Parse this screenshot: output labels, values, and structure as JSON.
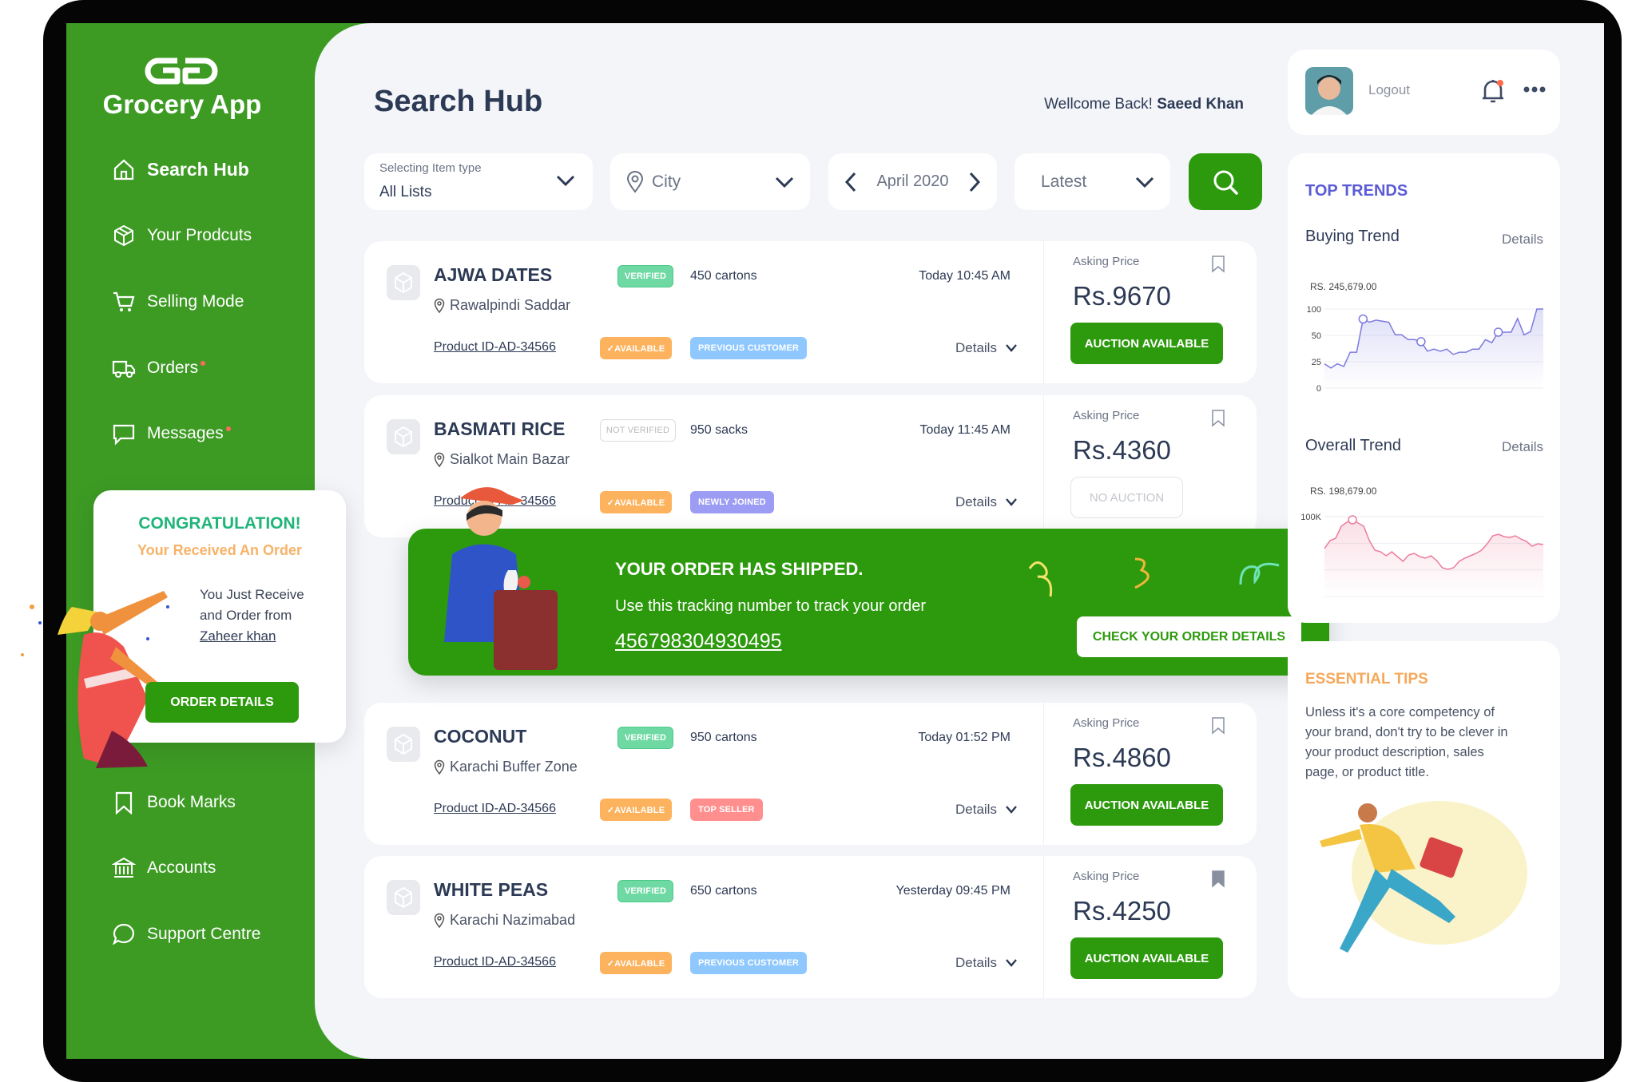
{
  "app": {
    "name": "Grocery App",
    "logo_icon": "gd-logo"
  },
  "sidebar": {
    "items": [
      {
        "label": "Search Hub",
        "icon": "home-icon",
        "active": true
      },
      {
        "label": "Your Prodcuts",
        "icon": "box-icon"
      },
      {
        "label": "Selling Mode",
        "icon": "cart-icon"
      },
      {
        "label": "Orders",
        "icon": "truck-icon",
        "dot": true
      },
      {
        "label": "Messages",
        "icon": "message-icon",
        "dot": true
      },
      {
        "label": "Book Marks",
        "icon": "bookmark-icon"
      },
      {
        "label": "Accounts",
        "icon": "bank-icon"
      },
      {
        "label": "Support Centre",
        "icon": "chat-icon"
      }
    ]
  },
  "congrats": {
    "title": "CONGRATULATION!",
    "subtitle": "Your Received An Order",
    "line1": "You Just Receive",
    "line2": "and Order from",
    "customer": "Zaheer khan",
    "button": "ORDER DETAILS"
  },
  "header": {
    "title": "Search Hub",
    "welcome": "Wellcome Back!",
    "user": "Saeed Khan"
  },
  "filters": {
    "item_type_label": "Selecting Item type",
    "item_type_value": "All Lists",
    "city": "City",
    "month": "April 2020",
    "sort": "Latest"
  },
  "listings": [
    {
      "name": "AJWA DATES",
      "verified": "VERIFIED",
      "verified_state": "verified",
      "qty": "450 cartons",
      "time": "Today 10:45 AM",
      "location": "Rawalpindi Saddar",
      "pid": "Product ID-AD-34566",
      "avail": "✓AVAILABLE",
      "tag": "PREVIOUS CUSTOMER",
      "tag_color": "#8fc8ff",
      "details": "Details",
      "asking": "Asking Price",
      "price": "Rs.9670",
      "action": "AUCTION AVAILABLE",
      "auction": true,
      "bookmarked": false
    },
    {
      "name": "BASMATI RICE",
      "verified": "NOT VERIFIED",
      "verified_state": "not",
      "qty": "950 sacks",
      "time": "Today 11:45 AM",
      "location": "Sialkot Main Bazar",
      "pid": "Product ID-AD-34566",
      "avail": "✓AVAILABLE",
      "tag": "NEWLY JOINED",
      "tag_color": "#9d9cf5",
      "details": "Details",
      "asking": "Asking Price",
      "price": "Rs.4360",
      "action": "NO AUCTION",
      "auction": false,
      "bookmarked": false
    },
    {
      "name": "COCONUT",
      "verified": "VERIFIED",
      "verified_state": "verified",
      "qty": "950 cartons",
      "time": "Today 01:52 PM",
      "location": "Karachi Buffer Zone",
      "pid": "Product ID-AD-34566",
      "avail": "✓AVAILABLE",
      "tag": "TOP SELLER",
      "tag_color": "#ff8f8f",
      "details": "Details",
      "asking": "Asking Price",
      "price": "Rs.4860",
      "action": "AUCTION AVAILABLE",
      "auction": true,
      "bookmarked": false
    },
    {
      "name": "WHITE PEAS",
      "verified": "VERIFIED",
      "verified_state": "verified",
      "qty": "650 cartons",
      "time": "Yesterday 09:45 PM",
      "location": "Karachi Nazimabad",
      "pid": "Product ID-AD-34566",
      "avail": "✓AVAILABLE",
      "tag": "PREVIOUS CUSTOMER",
      "tag_color": "#8fc8ff",
      "details": "Details",
      "asking": "Asking Price",
      "price": "Rs.4250",
      "action": "AUCTION AVAILABLE",
      "auction": true,
      "bookmarked": true
    }
  ],
  "banner": {
    "title": "YOUR ORDER HAS SHIPPED.",
    "subtitle": "Use this tracking number to track your order",
    "tracking": "456798304930495",
    "button": "CHECK YOUR ORDER DETAILS"
  },
  "profile": {
    "logout": "Logout",
    "notification_dot": true
  },
  "trends": {
    "title": "TOP TRENDS",
    "buying_title": "Buying Trend",
    "overall_title": "Overall Trend",
    "details": "Details"
  },
  "chart_data": [
    {
      "type": "area",
      "title": "Buying Trend",
      "value_label": "RS. 245,679.00",
      "yticks": [
        "100",
        "50",
        "25",
        "0"
      ],
      "ytick_values": [
        100,
        50,
        25,
        0
      ],
      "ylim": [
        0,
        100
      ],
      "color": "#7b79e0",
      "values": [
        23,
        19,
        23,
        20.5,
        34,
        34,
        81,
        75,
        79,
        77,
        75,
        51,
        51,
        46,
        46,
        44,
        35,
        37,
        35,
        37,
        32,
        34,
        34,
        37,
        37,
        46,
        43,
        56,
        56,
        56,
        82,
        51,
        57,
        100,
        100
      ],
      "markers": [
        6,
        15,
        27
      ]
    },
    {
      "type": "area",
      "title": "Overall Trend",
      "value_label": "RS. 198,679.00",
      "yticks": [
        "100K"
      ],
      "ytick_values": [
        100
      ],
      "ylim": [
        0,
        100
      ],
      "color": "#ec7d9c",
      "values": [
        60,
        70,
        73,
        88,
        93,
        96,
        92,
        88,
        70,
        58,
        56,
        51,
        56,
        50,
        44,
        52,
        54,
        50,
        48,
        51,
        45,
        36,
        34,
        36,
        44,
        48,
        51,
        54,
        58,
        66,
        76,
        78,
        75,
        74,
        76,
        72,
        69,
        63,
        66,
        65
      ],
      "markers": [
        5
      ]
    }
  ],
  "tips": {
    "title": "ESSENTIAL TIPS",
    "lines": [
      "Unless it's a core competency of",
      "your brand, don't try to be clever in",
      "your product description, sales",
      "page, or product title."
    ]
  },
  "colors": {
    "green": "#2d9a0d",
    "sidebar": "#3d9b24",
    "accent_purple": "#5b5bd6",
    "orange": "#f5a85a",
    "teal": "#1fb57a"
  }
}
